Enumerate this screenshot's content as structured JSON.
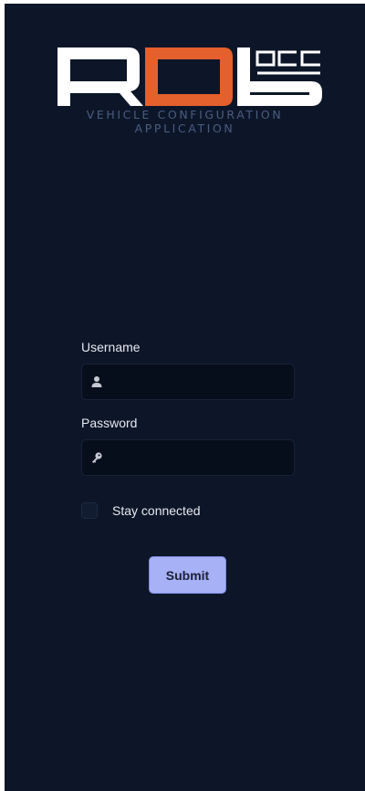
{
  "brand": {
    "logo_text": "ROB OCC",
    "subtitle_line1": "VEHICLE CONFIGURATION",
    "subtitle_line2": "APPLICATION",
    "accent_color": "#e4602c"
  },
  "form": {
    "username_label": "Username",
    "username_value": "",
    "password_label": "Password",
    "password_value": "",
    "stay_connected_label": "Stay connected",
    "stay_connected_checked": false,
    "submit_label": "Submit"
  },
  "icons": {
    "username": "user-icon",
    "password": "key-icon"
  }
}
